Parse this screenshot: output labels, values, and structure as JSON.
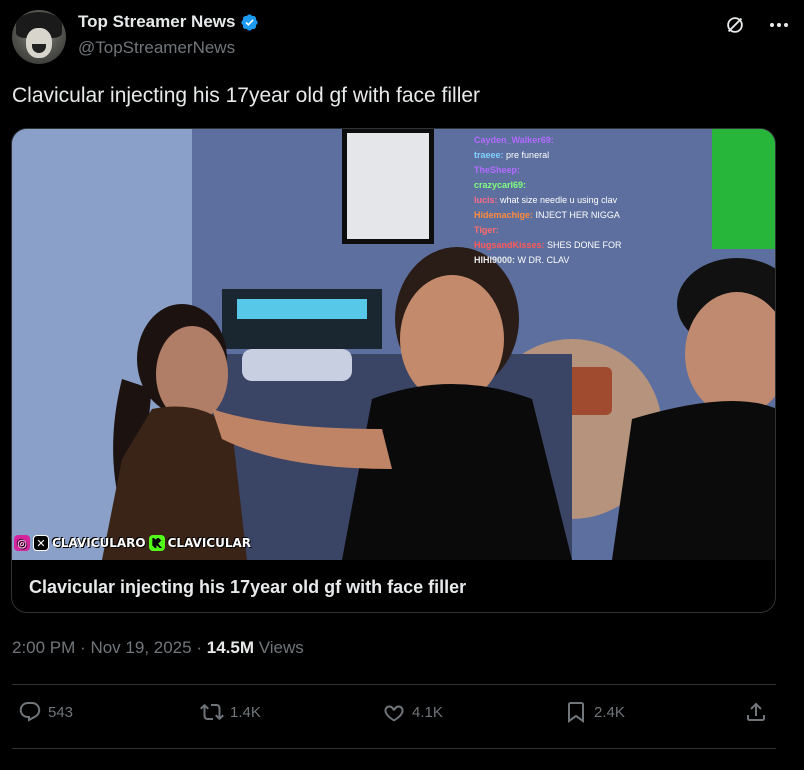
{
  "author": {
    "display_name": "Top Streamer News",
    "handle": "@TopStreamerNews"
  },
  "tweet": {
    "text": "Clavicular injecting his 17year old gf with face filler"
  },
  "media": {
    "card_title": "Clavicular injecting his 17year old gf with face filler",
    "watermark": "CLAVICULARO",
    "watermark2": "CLAVICULAR",
    "chat": [
      {
        "user": "Cayden_Walker69:",
        "msg": "",
        "color": "#b36bff"
      },
      {
        "user": "traeee:",
        "msg": "pre funeral",
        "color": "#7fd2ff"
      },
      {
        "user": "TheSheep:",
        "msg": "",
        "color": "#b36bff"
      },
      {
        "user": "crazycarl69:",
        "msg": "",
        "color": "#7fff7f"
      },
      {
        "user": "lucis:",
        "msg": "what size needle u using clav",
        "color": "#ff6b8a"
      },
      {
        "user": "Hidemachige:",
        "msg": "INJECT HER NIGGA",
        "color": "#ff8a3d"
      },
      {
        "user": "Tiger:",
        "msg": "",
        "color": "#ff6b6b"
      },
      {
        "user": "HugsandKisses:",
        "msg": "SHES DONE FOR",
        "color": "#ff5a5a"
      },
      {
        "user": "HIHI9000:",
        "msg": "W DR. CLAV",
        "color": "#e7e9ea"
      }
    ]
  },
  "meta": {
    "time": "2:00 PM",
    "date": "Nov 19, 2025",
    "separator": "·",
    "views_count": "14.5M",
    "views_label": "Views"
  },
  "actions": {
    "replies": "543",
    "reposts": "1.4K",
    "likes": "4.1K",
    "bookmarks": "2.4K"
  }
}
